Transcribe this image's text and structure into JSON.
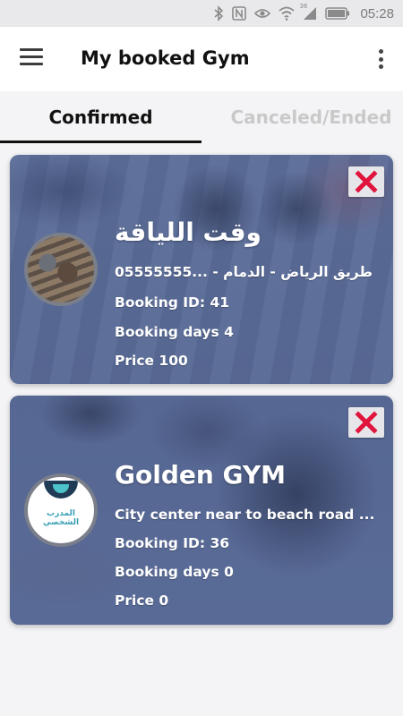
{
  "status_bar": {
    "time": "05:28",
    "icons": [
      "bluetooth-icon",
      "nfc-icon",
      "eye-icon",
      "wifi-icon",
      "signal-icon",
      "battery-icon"
    ],
    "network_label": "36"
  },
  "app_bar": {
    "title": "My booked Gym"
  },
  "tabs": [
    {
      "label": "Confirmed",
      "active": true
    },
    {
      "label": "Canceled/Ended",
      "active": false
    }
  ],
  "bookings": [
    {
      "name": "وقت اللياقة",
      "address": "طريق الرياض - الدمام - ...05555555",
      "booking_id": "Booking ID: 41",
      "booking_days": "Booking days 4",
      "price": "Price 100"
    },
    {
      "name": "Golden GYM",
      "address": "City center near to beach road ...",
      "booking_id": "Booking ID: 36",
      "booking_days": "Booking days 0",
      "price": "Price 0",
      "logo_text": "المدرب الشخصي"
    }
  ],
  "colors": {
    "card_tint": "#5a6a94",
    "close_icon": "#e0143c",
    "active_tab": "#111111",
    "inactive_tab": "#c9c9c9"
  }
}
